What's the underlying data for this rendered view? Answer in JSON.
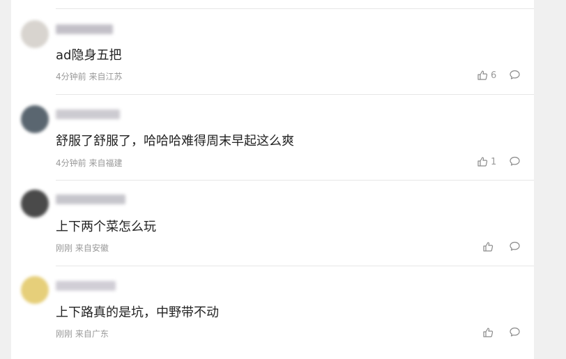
{
  "comments": [
    {
      "text": "ad隐身五把",
      "time": "4分钟前",
      "location": "来自江苏",
      "likes": "6",
      "avatar_color": "#d8d4cf",
      "username_color": "#b9b6bf"
    },
    {
      "text": "舒服了舒服了，哈哈哈难得周末早起这么爽",
      "time": "4分钟前",
      "location": "来自福建",
      "likes": "1",
      "avatar_color": "#5a6670",
      "username_color": "#c4c2c9"
    },
    {
      "text": "上下两个菜怎么玩",
      "time": "刚刚",
      "location": "来自安徽",
      "likes": "",
      "avatar_color": "#4a4a4a",
      "username_color": "#bdbcc3"
    },
    {
      "text": "上下路真的是坑，中野带不动",
      "time": "刚刚",
      "location": "来自广东",
      "likes": "",
      "avatar_color": "#e6cf7a",
      "username_color": "#c9c6cf"
    }
  ]
}
